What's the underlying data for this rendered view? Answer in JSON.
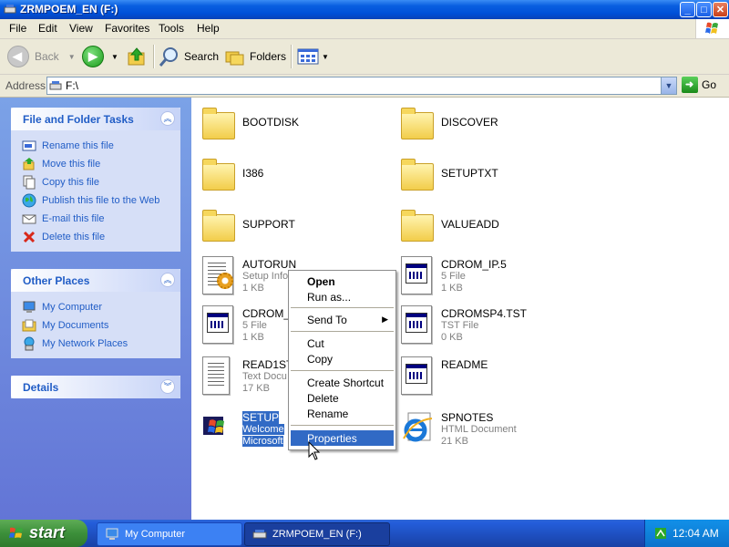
{
  "window": {
    "title": "ZRMPOEM_EN (F:)",
    "minimize": "_",
    "maximize": "□",
    "close": "✕"
  },
  "menu": [
    "File",
    "Edit",
    "View",
    "Favorites",
    "Tools",
    "Help"
  ],
  "toolbar": {
    "back": "Back",
    "search": "Search",
    "folders": "Folders"
  },
  "address": {
    "label": "Address",
    "value": "F:\\",
    "go": "Go"
  },
  "left_pane": {
    "file_tasks": {
      "title": "File and Folder Tasks",
      "items": [
        {
          "label": "Rename this file",
          "icon": "rename-icon"
        },
        {
          "label": "Move this file",
          "icon": "move-icon"
        },
        {
          "label": "Copy this file",
          "icon": "copy-icon"
        },
        {
          "label": "Publish this file to the Web",
          "icon": "web-icon"
        },
        {
          "label": "E-mail this file",
          "icon": "email-icon"
        },
        {
          "label": "Delete this file",
          "icon": "delete-icon"
        }
      ]
    },
    "other_places": {
      "title": "Other Places",
      "items": [
        {
          "label": "My Computer",
          "icon": "computer-icon"
        },
        {
          "label": "My Documents",
          "icon": "documents-icon"
        },
        {
          "label": "My Network Places",
          "icon": "network-icon"
        }
      ]
    },
    "details": {
      "title": "Details"
    }
  },
  "files": [
    {
      "name": "BOOTDISK",
      "type": "folder"
    },
    {
      "name": "DISCOVER",
      "type": "folder"
    },
    {
      "name": "I386",
      "type": "folder"
    },
    {
      "name": "SETUPTXT",
      "type": "folder"
    },
    {
      "name": "SUPPORT",
      "type": "folder"
    },
    {
      "name": "VALUEADD",
      "type": "folder"
    },
    {
      "name": "AUTORUN",
      "line2": "Setup Info",
      "line3": "1 KB",
      "type": "setup-info"
    },
    {
      "name": "CDROM_IP.5",
      "line2": "5 File",
      "line3": "1 KB",
      "type": "generic"
    },
    {
      "name": "CDROM_I",
      "line2": "5 File",
      "line3": "1 KB",
      "type": "generic"
    },
    {
      "name": "CDROMSP4.TST",
      "line2": "TST File",
      "line3": "0 KB",
      "type": "generic"
    },
    {
      "name": "READ1ST",
      "line2": "Text Docu",
      "line3": "17 KB",
      "type": "text"
    },
    {
      "name": "README",
      "line2": "",
      "line3": "",
      "type": "generic"
    },
    {
      "name": "SETUP",
      "line2": "Welcome",
      "line3": "Microsoft",
      "type": "setup-exe"
    },
    {
      "name": "SPNOTES",
      "line2": "HTML Document",
      "line3": "21 KB",
      "type": "html"
    }
  ],
  "context_menu": {
    "items": [
      "Open",
      "Run as...",
      "Send To",
      "Cut",
      "Copy",
      "Create Shortcut",
      "Delete",
      "Rename",
      "Properties"
    ],
    "submenu_arrow": "▶"
  },
  "taskbar": {
    "start": "start",
    "buttons": [
      "My Computer",
      "ZRMPOEM_EN (F:)"
    ],
    "clock": "12:04 AM"
  },
  "colors": {
    "title_blue": "#0050d8",
    "task_pane_blue": "#6375d6",
    "link_blue": "#215dc6",
    "selection": "#316ac5",
    "start_green": "#3c8f3a"
  }
}
